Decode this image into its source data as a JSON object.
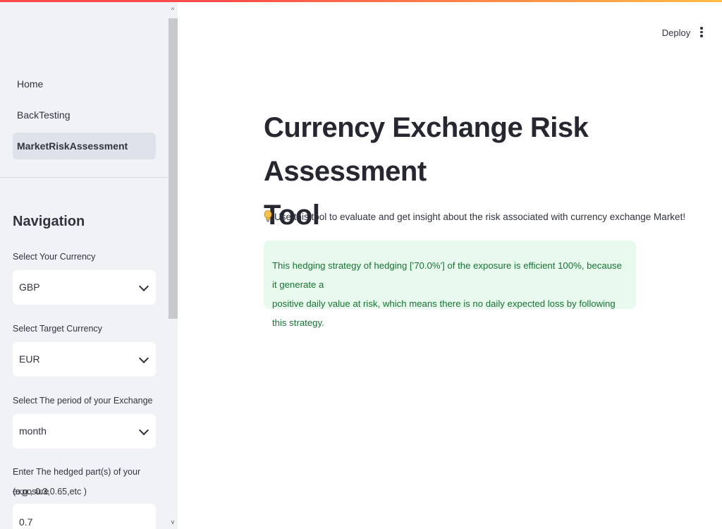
{
  "header": {
    "deploy_label": "Deploy",
    "menu_icon": "more-vertical-icon"
  },
  "sidebar": {
    "pages": [
      {
        "label": "Home",
        "active": false
      },
      {
        "label": "BackTesting",
        "active": false
      },
      {
        "label": "MarketRiskAssessment",
        "active": true
      }
    ],
    "heading": "Navigation",
    "currency": {
      "label": "Select Your Currency",
      "value": "GBP"
    },
    "target_currency": {
      "label": "Select Target Currency",
      "value": "EUR"
    },
    "period": {
      "label": "Select The period of your Exchange",
      "value": "month"
    },
    "hedged": {
      "label_line1": "Enter The hedged part(s) of your exposure",
      "label_line2": "(e.g., 0.3,0.65,etc )",
      "value": "0.7"
    },
    "scroll_up": "^",
    "scroll_down": "v"
  },
  "main": {
    "title_line1": "Currency Exchange Risk Assessment",
    "title_line2": "Tool",
    "intro_icon": "lightbulb-icon",
    "intro_text": "Use this tool to evaluate and get insight about the risk associated with currency exchange Market!",
    "result_line1": "This hedging strategy of hedging ['70.0%'] of the exposure is efficient 100%, because it generate a",
    "result_line2": "positive daily value at risk, which means there is no daily expected loss by following this strategy."
  },
  "colors": {
    "accent_red": "#ff4b4b",
    "accent_yellow": "#ffbd45",
    "sidebar_bg": "#f0f2f6",
    "success_bg": "#e8f9ee",
    "success_text": "#177233"
  }
}
